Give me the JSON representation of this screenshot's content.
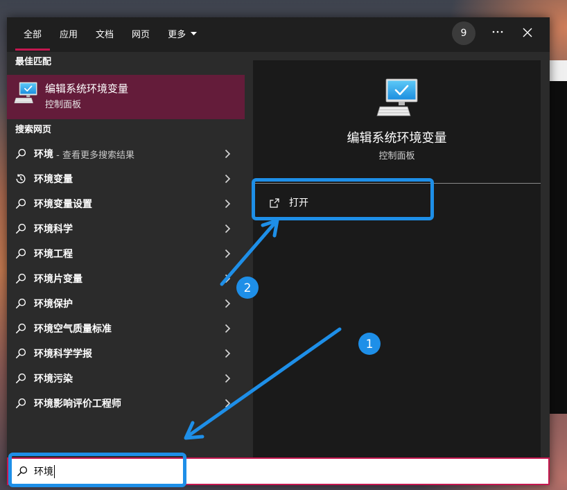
{
  "tabs": [
    {
      "label": "全部",
      "active": true
    },
    {
      "label": "应用",
      "active": false
    },
    {
      "label": "文档",
      "active": false
    },
    {
      "label": "网页",
      "active": false
    },
    {
      "label": "更多",
      "active": false,
      "icon": "dropdown-arrow-icon"
    }
  ],
  "toolbar": {
    "rewards_count": "9",
    "more_icon": "ellipsis-icon",
    "close_icon": "close-icon"
  },
  "best_match": {
    "header": "最佳匹配",
    "title": "编辑系统环境变量",
    "subtitle": "控制面板",
    "icon": "computer-monitor-icon"
  },
  "web_search": {
    "header": "搜索网页",
    "items": [
      {
        "icon": "search-icon",
        "label": "环境",
        "hint": " - 查看更多搜索结果"
      },
      {
        "icon": "history-icon",
        "label": "环境变量"
      },
      {
        "icon": "search-icon",
        "label": "环境变量设置"
      },
      {
        "icon": "search-icon",
        "label": "环境科学"
      },
      {
        "icon": "search-icon",
        "label": "环境工程"
      },
      {
        "icon": "search-icon",
        "label": "环境片变量"
      },
      {
        "icon": "search-icon",
        "label": "环境保护"
      },
      {
        "icon": "search-icon",
        "label": "环境空气质量标准"
      },
      {
        "icon": "search-icon",
        "label": "环境科学学报"
      },
      {
        "icon": "search-icon",
        "label": "环境污染"
      },
      {
        "icon": "search-icon",
        "label": "环境影响评价工程师"
      }
    ]
  },
  "preview": {
    "title": "编辑系统环境变量",
    "subtitle": "控制面板",
    "icon": "computer-monitor-icon",
    "actions": [
      {
        "label": "打开",
        "icon": "open-icon"
      }
    ]
  },
  "search": {
    "value": "环境",
    "icon": "search-icon"
  },
  "annotations": {
    "step_labels": [
      "1",
      "2"
    ]
  },
  "colors": {
    "accent": "#c4174f",
    "best_match_bg": "#641c3a",
    "annotation": "#1e8fe8"
  }
}
